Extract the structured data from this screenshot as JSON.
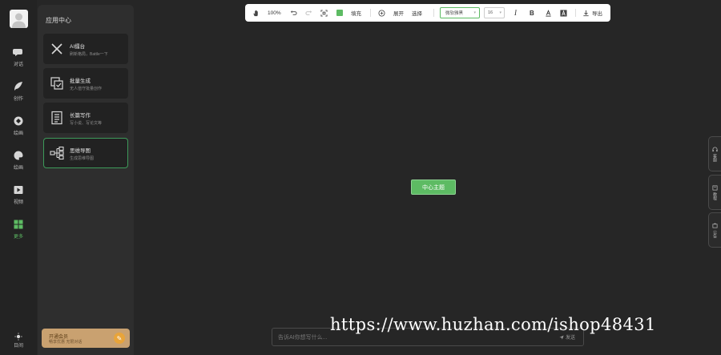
{
  "rail": {
    "items": [
      {
        "label": "对话",
        "icon": "chat-icon"
      },
      {
        "label": "创作",
        "icon": "feather-icon"
      },
      {
        "label": "绘画",
        "icon": "brush-icon"
      },
      {
        "label": "绘画",
        "icon": "palette-icon"
      },
      {
        "label": "视频",
        "icon": "video-icon"
      },
      {
        "label": "更多",
        "icon": "grid-icon"
      }
    ],
    "theme_label": "日间"
  },
  "panel": {
    "title": "应用中心",
    "cards": [
      {
        "title": "AI擂台",
        "subtitle": "刷新格局，Battle一下",
        "icon": "swords-icon"
      },
      {
        "title": "批量生成",
        "subtitle": "无人值守批量创作",
        "icon": "batch-icon"
      },
      {
        "title": "长篇写作",
        "subtitle": "写小说、写论文等",
        "icon": "document-icon"
      },
      {
        "title": "思维导图",
        "subtitle": "生成思维导图",
        "icon": "mindmap-icon"
      }
    ],
    "promo": {
      "title": "开通会员",
      "subtitle": "畅享优惠 无限对话",
      "icon": "pencil-icon"
    }
  },
  "toolbar": {
    "zoom": "100%",
    "fill_label": "填充",
    "expand_label": "展开",
    "select_label": "选择",
    "font_value": "微软雅黑",
    "size_value": "16",
    "export_label": "导出",
    "fill_color": "#5dbb63"
  },
  "canvas": {
    "center_node": "中心主题"
  },
  "side_tabs": [
    {
      "label": "客服",
      "icon": "headset-icon"
    },
    {
      "label": "教程",
      "icon": "book-icon"
    },
    {
      "label": "公告",
      "icon": "notice-icon"
    }
  ],
  "input": {
    "placeholder": "告诉AI你想写什么...",
    "send_label": "发送"
  },
  "watermark": "https://www.huzhan.com/ishop48431",
  "colors": {
    "accent": "#5dbb63",
    "background": "#262626",
    "panel": "#2e2e2e"
  }
}
